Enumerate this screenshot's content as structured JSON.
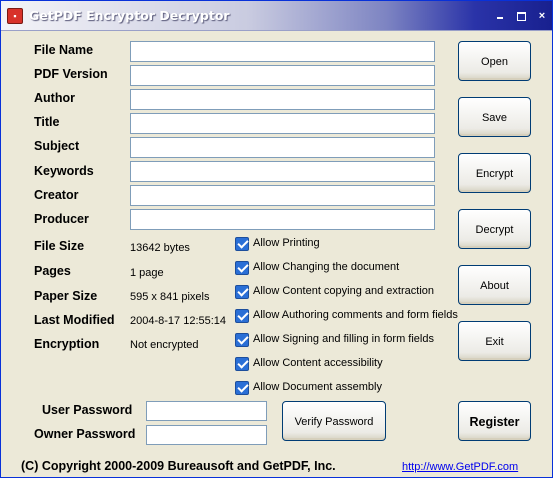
{
  "window": {
    "title": "GetPDF Encryptor Decryptor",
    "icon": "pdf-icon",
    "controls": {
      "minimize": "",
      "maximize": "",
      "close": "×"
    }
  },
  "fields": [
    {
      "label": "File Name",
      "value": ""
    },
    {
      "label": "PDF Version",
      "value": ""
    },
    {
      "label": "Author",
      "value": ""
    },
    {
      "label": "Title",
      "value": ""
    },
    {
      "label": "Subject",
      "value": ""
    },
    {
      "label": "Keywords",
      "value": ""
    },
    {
      "label": "Creator",
      "value": ""
    },
    {
      "label": "Producer",
      "value": ""
    }
  ],
  "info": [
    {
      "label": "File Size",
      "value": "13642 bytes"
    },
    {
      "label": "Pages",
      "value": "1 page"
    },
    {
      "label": "Paper Size",
      "value": "595 x 841 pixels"
    },
    {
      "label": "Last Modified",
      "value": "2004-8-17 12:55:14"
    },
    {
      "label": "Encryption",
      "value": "Not encrypted"
    }
  ],
  "permissions": [
    {
      "label": "Allow Printing",
      "checked": true
    },
    {
      "label": "Allow Changing the document",
      "checked": true
    },
    {
      "label": "Allow Content copying and extraction",
      "checked": true
    },
    {
      "label": "Allow Authoring comments and form fields",
      "checked": true
    },
    {
      "label": "Allow Signing and filling in form fields",
      "checked": true
    },
    {
      "label": "Allow Content accessibility",
      "checked": true
    },
    {
      "label": "Allow Document assembly",
      "checked": true
    }
  ],
  "buttons": {
    "open": "Open",
    "save": "Save",
    "encrypt": "Encrypt",
    "decrypt": "Decrypt",
    "about": "About",
    "exit": "Exit",
    "verify": "Verify Password",
    "register": "Register"
  },
  "passwords": {
    "user_label": "User Password",
    "user_value": "",
    "owner_label": "Owner Password",
    "owner_value": ""
  },
  "footer": {
    "copyright": "(C) Copyright 2000-2009 Bureausoft and GetPDF, Inc.",
    "link": "http://www.GetPDF.com"
  },
  "colors": {
    "title_bar_dark": "#18208f",
    "window_bg": "#ece9d8",
    "link": "#0000ee",
    "checkbox": "#2a6fd6"
  }
}
